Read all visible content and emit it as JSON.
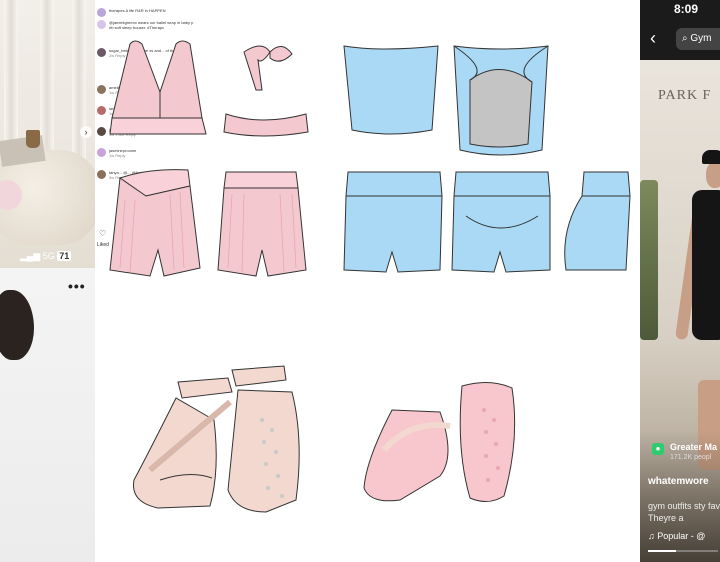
{
  "left_panel": {
    "status_text": "5G",
    "battery": "71",
    "more_label": "•••"
  },
  "comments": {
    "items": [
      {
        "text": "therapes A life R&R in HAPPEN",
        "sub": "",
        "color": "#b9a6d6"
      },
      {
        "text": "@jamiekgreenx wears our ballet wrap in baby p",
        "sub": "rib soft sleep trouser. #Therapc",
        "color": "#d7c4ec"
      },
      {
        "text": "sugar_bebe  this is the xs and... of the ...",
        "sub": "2w  Reply",
        "color": "#6b5a66"
      },
      {
        "text": "amelie...  ...uist set!",
        "sub": "1w  Reply",
        "color": "#8a7460"
      },
      {
        "text": "iami...  ...",
        "sub": "1w  Reply",
        "color": "#b86b6b"
      },
      {
        "text": "jess...",
        "sub": "1w  1 like  Reply",
        "color": "#5a4a44"
      },
      {
        "text": "jasmineproome",
        "sub": "1w  Reply",
        "color": "#c7a3d9"
      },
      {
        "text": "tanya...  @...  @llari_crest",
        "sub": "3w  Reply",
        "color": "#8c6f5a"
      }
    ],
    "likes_label": "Liked"
  },
  "design": {
    "colors": {
      "pink": "#f4c8cf",
      "pink_dark": "#e8a8b2",
      "blue": "#a9d9f5",
      "gray": "#c4c4c4",
      "beige": "#f2d8cf",
      "beige_dark": "#d9b8ab",
      "sole": "#c9c9c9"
    }
  },
  "phone": {
    "time": "8:09",
    "search_text": "Gym",
    "sign_text": "PARK F",
    "location": "Greater Ma",
    "location_sub": "171.2K peopl",
    "username": "whatemwore",
    "description": "gym outfits sty fave? Theyre a",
    "music": "♫ Popular - @",
    "progress": 0.4
  }
}
